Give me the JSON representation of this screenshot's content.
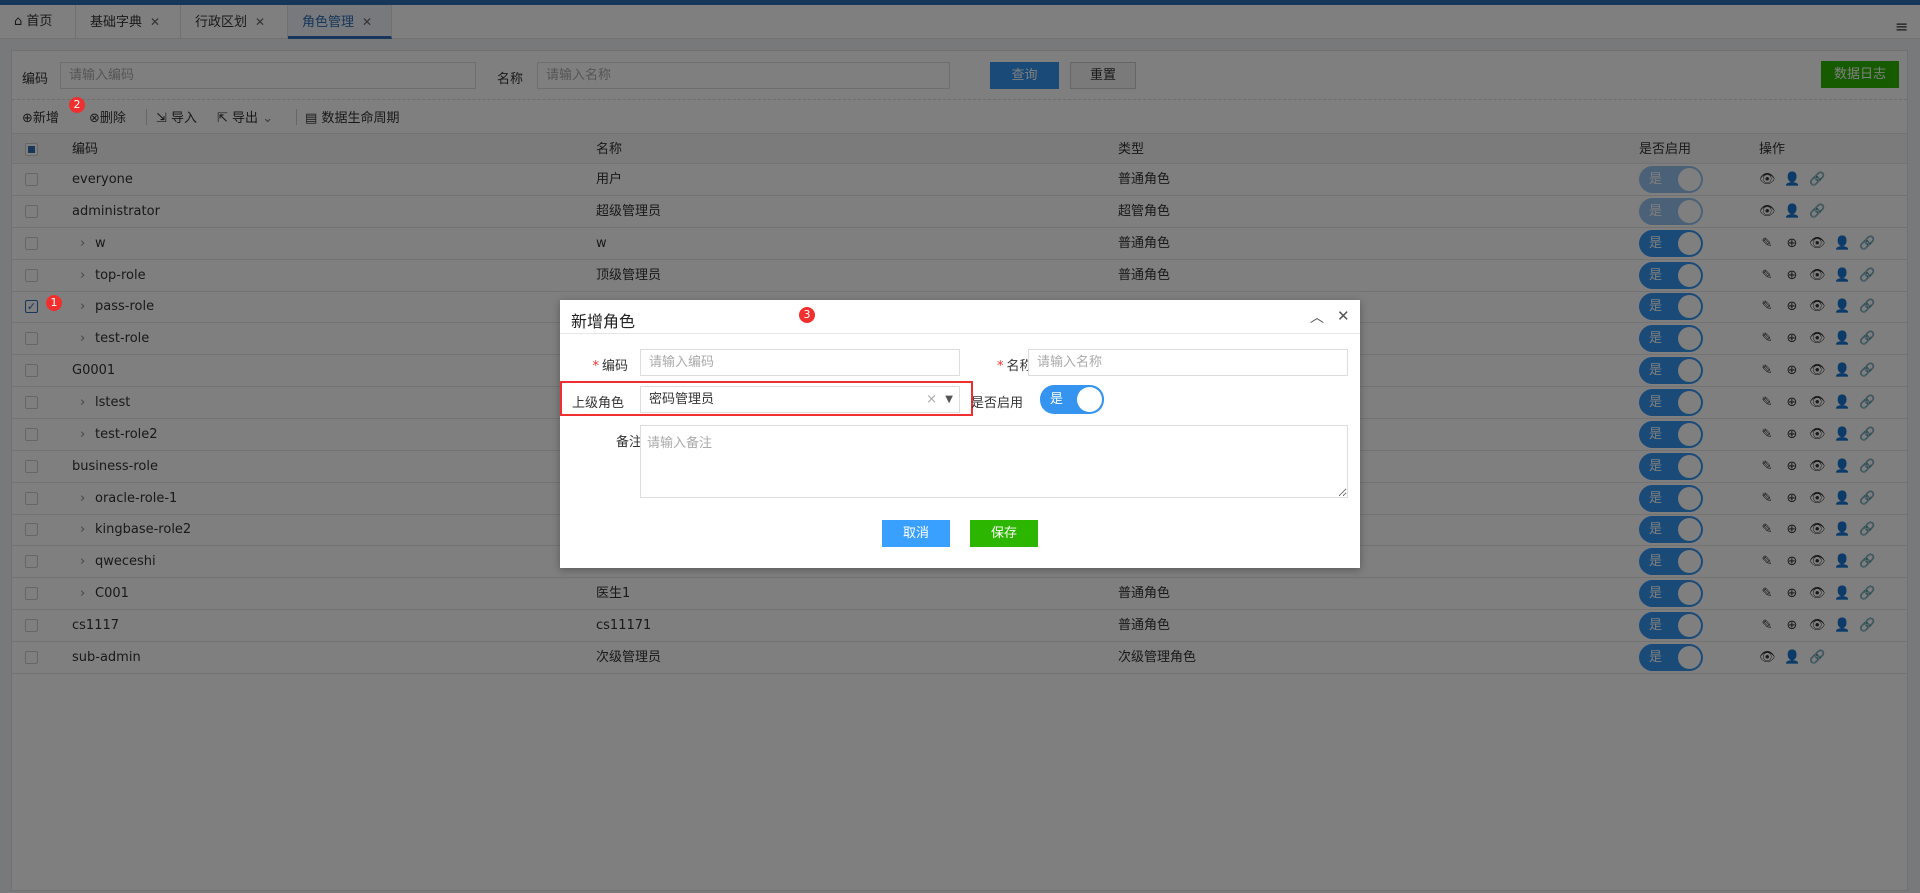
{
  "tabs": [
    {
      "label": "首页",
      "icon": "home-icon"
    },
    {
      "label": "基础字典"
    },
    {
      "label": "行政区划"
    },
    {
      "label": "角色管理",
      "active": true
    }
  ],
  "search": {
    "code_label": "编码",
    "code_placeholder": "请输入编码",
    "name_label": "名称",
    "name_placeholder": "请输入名称",
    "query": "查询",
    "reset": "重置",
    "data_log": "数据日志"
  },
  "toolbar": {
    "add": "新增",
    "delete": "删除",
    "import": "导入",
    "export": "导出",
    "lifecycle": "数据生命周期"
  },
  "badges": {
    "b1": "1",
    "b2": "2",
    "b3": "3"
  },
  "table": {
    "headers": [
      "编码",
      "名称",
      "类型",
      "是否启用",
      "操作"
    ],
    "rows": [
      {
        "code": "everyone",
        "name": "用户",
        "type": "普通角色",
        "child": false,
        "enabled": "是",
        "disabled": true,
        "ops": "basic"
      },
      {
        "code": "administrator",
        "name": "超级管理员",
        "type": "超管角色",
        "child": false,
        "enabled": "是",
        "disabled": true,
        "ops": "basic"
      },
      {
        "code": "w",
        "name": "w",
        "type": "普通角色",
        "child": true,
        "enabled": "是",
        "ops": "full"
      },
      {
        "code": "top-role",
        "name": "顶级管理员",
        "type": "普通角色",
        "child": true,
        "enabled": "是",
        "ops": "full"
      },
      {
        "code": "pass-role",
        "name": "",
        "type": "",
        "child": true,
        "checked": true,
        "enabled": "是",
        "ops": "full"
      },
      {
        "code": "test-role",
        "name": "",
        "type": "",
        "child": true,
        "enabled": "是",
        "ops": "full"
      },
      {
        "code": "G0001",
        "name": "",
        "type": "",
        "child": false,
        "enabled": "是",
        "ops": "full"
      },
      {
        "code": "lstest",
        "name": "",
        "type": "",
        "child": true,
        "enabled": "是",
        "ops": "full"
      },
      {
        "code": "test-role2",
        "name": "",
        "type": "",
        "child": true,
        "enabled": "是",
        "ops": "full"
      },
      {
        "code": "business-role",
        "name": "",
        "type": "",
        "child": false,
        "enabled": "是",
        "ops": "full"
      },
      {
        "code": "oracle-role-1",
        "name": "",
        "type": "",
        "child": true,
        "enabled": "是",
        "ops": "full"
      },
      {
        "code": "kingbase-role2",
        "name": "",
        "type": "",
        "child": true,
        "enabled": "是",
        "ops": "full"
      },
      {
        "code": "qweceshi",
        "name": "",
        "type": "",
        "child": true,
        "enabled": "是",
        "ops": "full"
      },
      {
        "code": "C001",
        "name": "医生1",
        "type": "普通角色",
        "child": true,
        "enabled": "是",
        "ops": "full"
      },
      {
        "code": "cs1117",
        "name": "cs11171",
        "type": "普通角色",
        "child": false,
        "enabled": "是",
        "ops": "full"
      },
      {
        "code": "sub-admin",
        "name": "次级管理员",
        "type": "次级管理角色",
        "child": false,
        "enabled": "是",
        "ops": "basic"
      }
    ]
  },
  "dialog": {
    "title": "新增角色",
    "code_label": "编码",
    "code_placeholder": "请输入编码",
    "name_label": "名称",
    "name_placeholder": "请输入名称",
    "parent_label": "上级角色",
    "parent_value": "密码管理员",
    "enabled_label": "是否启用",
    "enabled_value": "是",
    "remark_label": "备注",
    "remark_placeholder": "请输入备注",
    "cancel": "取消",
    "save": "保存"
  },
  "colors": {
    "primary": "#3494f0",
    "save": "#2db600",
    "brand": "#2d6db5",
    "highlight": "#f03030"
  }
}
